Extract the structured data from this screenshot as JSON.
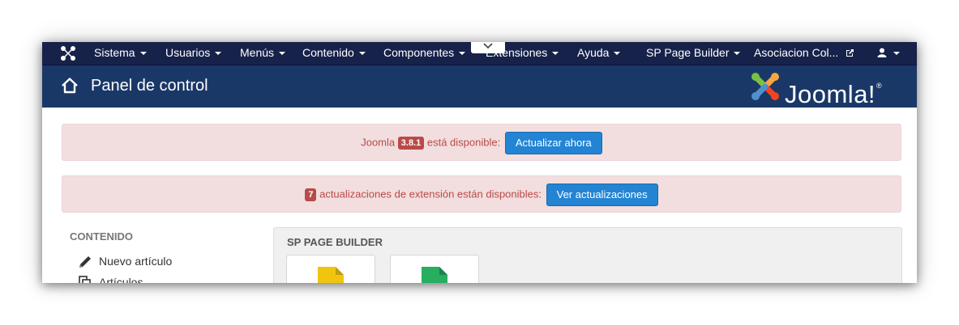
{
  "navbar": {
    "items": [
      {
        "label": "Sistema"
      },
      {
        "label": "Usuarios"
      },
      {
        "label": "Menús"
      },
      {
        "label": "Contenido"
      },
      {
        "label": "Componentes"
      },
      {
        "label": "Extensiones"
      },
      {
        "label": "Ayuda"
      },
      {
        "label": "SP Page Builder"
      },
      {
        "label": "Asociacion Col..."
      }
    ]
  },
  "header": {
    "title": "Panel de control",
    "brand": "Joomla!",
    "brand_mark": "®"
  },
  "alerts": {
    "update": {
      "prefix": "Joomla",
      "version": "3.8.1",
      "suffix": "está disponible:",
      "button": "Actualizar ahora"
    },
    "extensions": {
      "count": "7",
      "text": "actualizaciones de extensión están disponibles:",
      "button": "Ver actualizaciones"
    }
  },
  "sidebar": {
    "heading": "CONTENIDO",
    "items": [
      {
        "label": "Nuevo artículo",
        "icon": "pencil-icon"
      },
      {
        "label": "Artículos",
        "icon": "copy-icon"
      }
    ]
  },
  "panel": {
    "title": "SP PAGE BUILDER",
    "tiles": [
      {
        "icon": "yellow-page-icon",
        "color": "#f1c40f"
      },
      {
        "icon": "green-page-icon",
        "color": "#27ae60"
      }
    ]
  },
  "colors": {
    "navbar": "#17224a",
    "header": "#1a3867",
    "alert_bg": "#f2dede",
    "alert_text": "#b94a48",
    "button": "#2384d3"
  }
}
